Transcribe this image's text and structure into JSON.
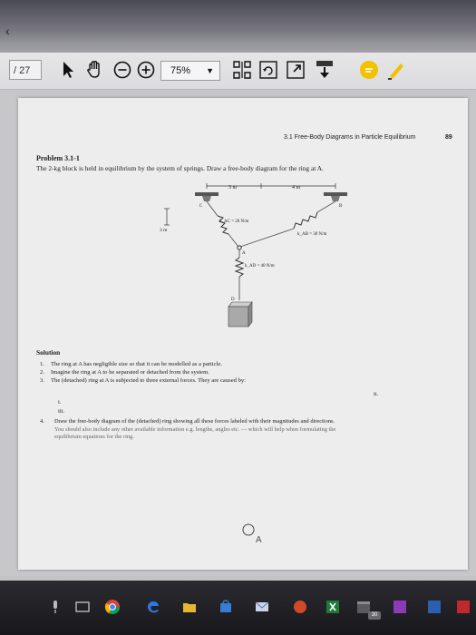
{
  "toolbar": {
    "page_count": "/ 27",
    "zoom": "75%",
    "icons": [
      "back-glyph",
      "select-arrow-icon",
      "hand-icon",
      "zoom-out-icon",
      "zoom-in-icon",
      "fit-page-icon",
      "rotate-icon",
      "fullscreen-icon",
      "download-icon",
      "comment-icon",
      "highlight-pen-icon"
    ]
  },
  "page": {
    "section_header": "3.1  Free-Body Diagrams in Particle Equilibrium",
    "page_number": "89",
    "problem_title": "Problem 3.1-1",
    "problem_text": "The 2-kg block is held in equilibrium by the system of springs. Draw a free-body diagram for the ring at A.",
    "figure": {
      "dim_3m_top": "3 m",
      "dim_4m_top": "4 m",
      "dim_3m_side": "3 m",
      "k_ac": "k_AC = 20 N/m",
      "k_ab": "k_AB = 30 N/m",
      "k_ad": "k_AD = 40 N/m",
      "label_a": "A",
      "label_b": "B",
      "label_c": "C",
      "label_d": "D"
    },
    "solution_title": "Solution",
    "steps": [
      "The ring at A has negligible size so that it can be modelled as a particle.",
      "Imagine the ring at A to be separated or detached from the system.",
      "The (detached) ring at A is subjected to three external forces. They are caused by:"
    ],
    "roman": [
      "i.",
      "ii.",
      "iii."
    ],
    "step4_num": "4.",
    "step4_line1": "Draw the free-body diagram of the (detached) ring showing all these forces labeled with their magnitudes and directions.",
    "step4_line2": "You should also include any other available information e.g. lengths, angles etc. — which will help when formulating the",
    "step4_line3": "equilibrium equations for the ring.",
    "handwritten_label": "A"
  },
  "taskbar": {
    "badge": "30"
  },
  "colors": {
    "toolbar_bg": "#dcdcdf",
    "page_bg": "#ededee",
    "taskbar_bg": "#18181c",
    "edge_blue": "#2a7ae2",
    "comment_yellow": "#f2c200",
    "excel_green": "#1f7a3a"
  }
}
